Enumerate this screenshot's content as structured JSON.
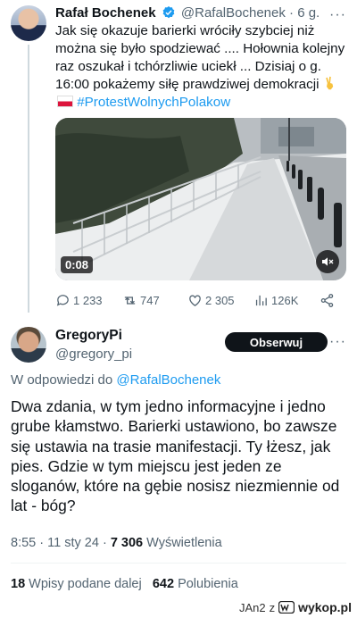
{
  "tweet": {
    "author_name": "Rafał Bochenek",
    "author_handle": "@RafalBochenek",
    "separator": "·",
    "time": "6 g.",
    "more": "···",
    "text": "Jak się okazuje barierki wróciły szybciej niż można się było spodziewać .... Hołownia kolejny raz oszukał i tchórzliwie uciekł ... Dzisiaj o g. 16:00 pokażemy siłę prawdziwej demokracji",
    "hashtag": "#ProtestWolnychPolakow",
    "video_duration": "0:08",
    "actions": {
      "replies": "1 233",
      "retweets": "747",
      "likes": "2 305",
      "views": "126K"
    }
  },
  "reply": {
    "author_name": "GregoryPi",
    "author_handle": "@gregory_pi",
    "follow_label": "Obserwuj",
    "more": "···",
    "in_reply_prefix": "W odpowiedzi do",
    "in_reply_handle": "@RafalBochenek",
    "text": "Dwa zdania, w tym jedno informacyjne i jedno grube kłamstwo. Barierki ustawiono, bo zawsze się ustawia na trasie manifestacji. Ty łżesz, jak pies. Gdzie w tym miejscu jest jeden ze sloganów, które na gębie nosisz niezmiennie od lat - bóg?",
    "time": "8:55",
    "date": "11 sty 24",
    "separator": "·",
    "views": "7 306",
    "views_label": "Wyświetlenia",
    "retweets": "18",
    "retweets_label": "Wpisy podane dalej",
    "likes": "642",
    "likes_label": "Polubienia"
  },
  "watermark": {
    "user": "JAn2",
    "prefix": "z",
    "site": "wykop.pl"
  },
  "colors": {
    "accent": "#1d9bf0",
    "text": "#0f1419",
    "secondary": "#536471"
  }
}
